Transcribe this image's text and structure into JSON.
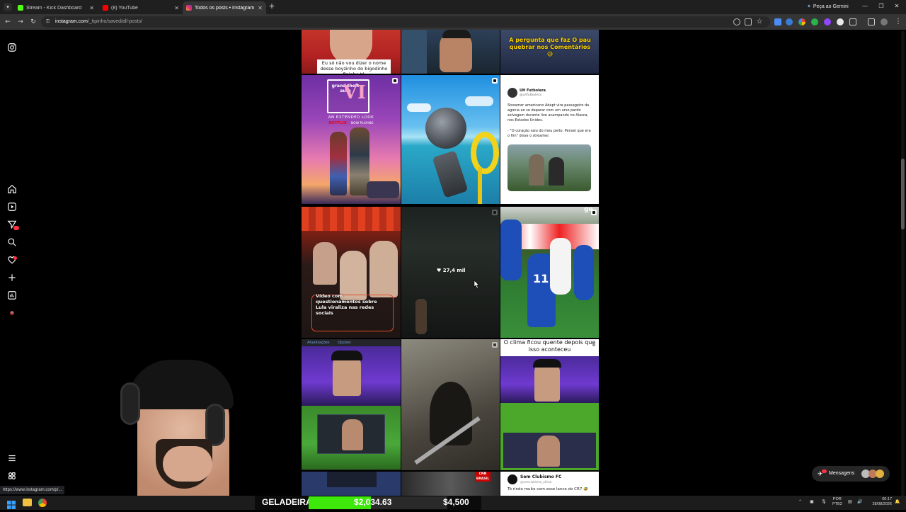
{
  "browser": {
    "tabs": [
      {
        "title": "Stream - Kick Dashboard",
        "favicon_color": "#53fc18",
        "active": false
      },
      {
        "title": "(8) YouTube",
        "favicon_color": "#ff0000",
        "active": false
      },
      {
        "title": "Todos os posts • Instagram",
        "favicon_color": "#e1306c",
        "active": true
      }
    ],
    "new_tab": "+",
    "gemini_label": "Peça ao Gemini",
    "url_host": "instagram.com",
    "url_path": "/_tipinho/saved/all-posts/",
    "status_url": "https://www.instagram.com/p/..."
  },
  "feed": {
    "captions": {
      "top_left": "Eu só não vou dizer o nome desse boyzinho do bigodinho fininho tá",
      "top_right": "A pergunta que faz O pau quebrar nos Comentários 😅",
      "gta_title": "grand theft auto",
      "gta_roman": "VI",
      "gta_sub": "AN EXTENDED LOOK",
      "gta_brand": "NETFLIX",
      "gta_now": "NOW PLAYING",
      "tweet_name": "UH Futbolera",
      "tweet_handle": "@uhfutbolera",
      "tweet_body": "Streamer americano Adapt vira passageiro da agonia ao se deparar com um urso pardo selvagem durante live acampando no Alasca, nos Estados Unidos.",
      "tweet_quote": "- \"O coração saiu do meu peito. Pensei que era o fim\" disse o streamer.",
      "lula_caption": "Vídeo com questionamentos sobre Lula viraliza nas redes sociais",
      "likes": "27,4 mil",
      "ge_logo": "ge",
      "soccer_number": "11",
      "clima_caption": "O clima ficou quente depois que isso aconteceu",
      "cnn_logo": "CNN BRASIL",
      "sem_name": "Sem Clubismo FC",
      "sem_handle": "@semclubismo_oficial",
      "sem_body": "Tô rindo muito com esse lance do CR7 🤣",
      "stream_labels": [
        "Atualizações",
        "Opções"
      ]
    }
  },
  "messages": {
    "label": "Mensagens"
  },
  "taskbar": {
    "lang": "POR",
    "lang2": "PTB2",
    "time": "00:17",
    "date": "28/08/2026"
  },
  "overlay": {
    "label": "GELADEIRA",
    "amount1": "$2,034.63",
    "amount2": "$4,500",
    "progress": 0.45
  }
}
